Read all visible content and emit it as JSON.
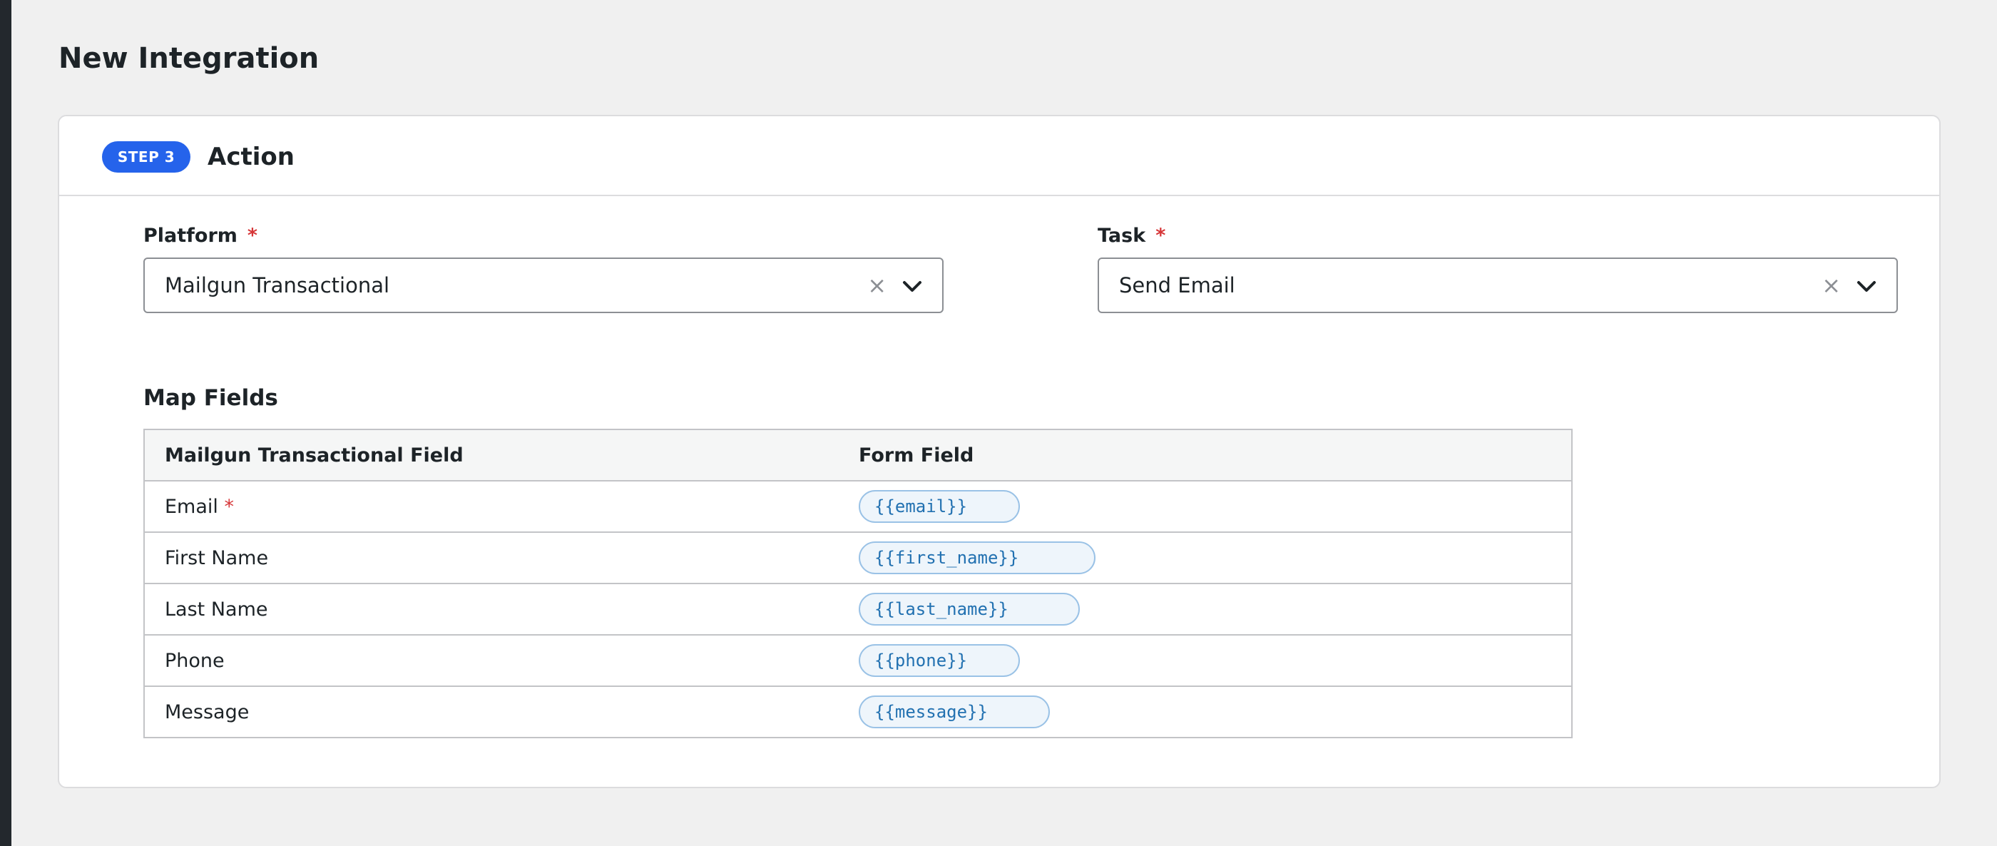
{
  "page": {
    "title": "New Integration"
  },
  "step": {
    "badge": "STEP 3",
    "title": "Action"
  },
  "platform": {
    "label": "Platform",
    "required_mark": "*",
    "value": "Mailgun Transactional"
  },
  "task": {
    "label": "Task",
    "required_mark": "*",
    "value": "Send Email"
  },
  "icons": {
    "clear": "×"
  },
  "map_fields": {
    "title": "Map Fields",
    "headers": [
      "Mailgun Transactional Field",
      "Form Field"
    ],
    "rows": [
      {
        "field": "Email",
        "required_mark": "*",
        "token": "{{email}}"
      },
      {
        "field": "First Name",
        "token": "{{first_name}}"
      },
      {
        "field": "Last Name",
        "token": "{{last_name}}"
      },
      {
        "field": "Phone",
        "token": "{{phone}}"
      },
      {
        "field": "Message",
        "token": "{{message}}"
      }
    ]
  },
  "colors": {
    "accent": "#2563eb",
    "required": "#d63638",
    "token": "#2271b1"
  }
}
